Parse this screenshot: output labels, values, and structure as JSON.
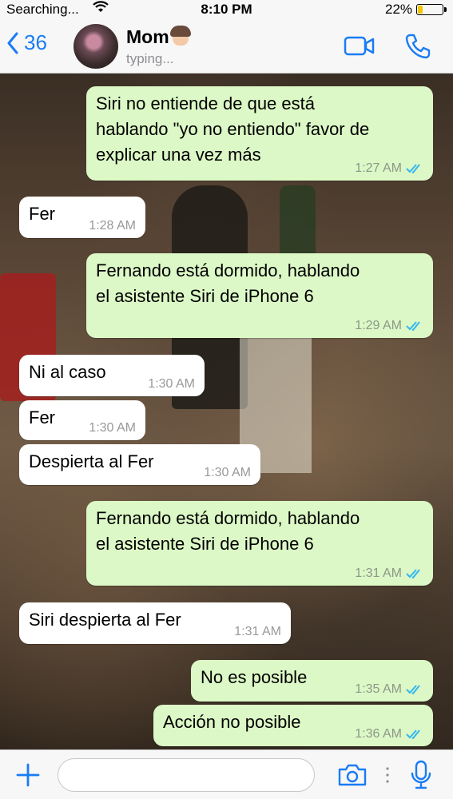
{
  "status_bar": {
    "carrier": "Searching...",
    "time": "8:10 PM",
    "battery_percent": "22%",
    "battery_level": 0.22
  },
  "nav": {
    "back_count": "36",
    "contact_name": "Mom",
    "contact_status": "typing..."
  },
  "messages": [
    {
      "dir": "out",
      "text": "Siri no entiende de que está\nhablando \"yo no entiendo\" favor de\nexplicar una vez más",
      "time": "1:27 AM"
    },
    {
      "dir": "in",
      "text": "Fer",
      "time": "1:28 AM"
    },
    {
      "dir": "out",
      "text": "Fernando está dormido, hablando\nel asistente Siri de iPhone 6",
      "time": "1:29 AM"
    },
    {
      "dir": "in",
      "text": "Ni al caso",
      "time": "1:30 AM"
    },
    {
      "dir": "in",
      "text": "Fer",
      "time": "1:30 AM"
    },
    {
      "dir": "in",
      "text": "Despierta al Fer",
      "time": "1:30 AM"
    },
    {
      "dir": "out",
      "text": "Fernando está dormido, hablando\nel asistente Siri de iPhone 6",
      "time": "1:31 AM"
    },
    {
      "dir": "in",
      "text": "Siri despierta al Fer",
      "time": "1:31 AM"
    },
    {
      "dir": "out",
      "text": "No es posible",
      "time": "1:35 AM"
    },
    {
      "dir": "out",
      "text": "Acción no posible",
      "time": "1:36 AM"
    }
  ],
  "colors": {
    "accent": "#1a7cf5",
    "outgoing_bubble": "#dcf8c6",
    "incoming_bubble": "#ffffff",
    "read_ticks": "#34b7f1"
  },
  "icons": {
    "back": "chevron-left-icon",
    "video": "video-call-icon",
    "call": "phone-icon",
    "plus": "plus-icon",
    "camera": "camera-icon",
    "mic": "microphone-icon"
  }
}
